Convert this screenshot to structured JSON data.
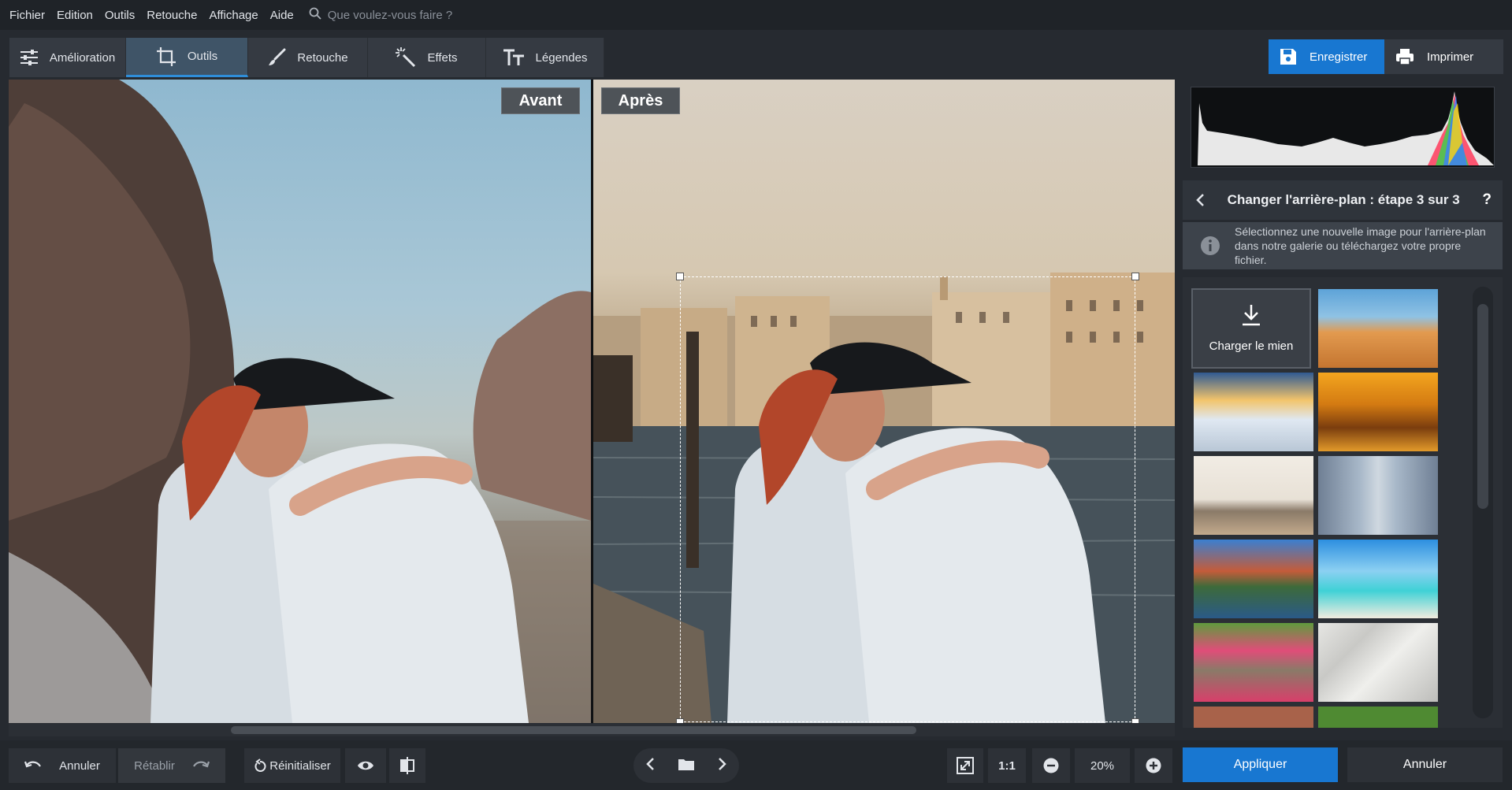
{
  "menu": [
    "Fichier",
    "Edition",
    "Outils",
    "Retouche",
    "Affichage",
    "Aide"
  ],
  "search": {
    "placeholder": "Que voulez-vous faire ?"
  },
  "toolbar": {
    "tabs": [
      "Amélioration",
      "Outils",
      "Retouche",
      "Effets",
      "Légendes"
    ],
    "active_tab": "Outils",
    "save_label": "Enregistrer",
    "print_label": "Imprimer"
  },
  "canvas": {
    "before_label": "Avant",
    "after_label": "Après"
  },
  "panel": {
    "step_title": "Changer l'arrière-plan : étape 3 sur 3",
    "help": "?",
    "info_text": "Sélectionnez une nouvelle image pour l'arrière-plan dans notre galerie ou téléchargez votre propre fichier.",
    "upload_label": "Charger le mien",
    "gallery": [
      "desert",
      "winter-road",
      "autumn-park",
      "living-room",
      "city-street",
      "canal-town",
      "tropical-beach",
      "flower-garden",
      "crumpled-paper",
      "brick-wall",
      "green-trees"
    ]
  },
  "bottom": {
    "undo_label": "Annuler",
    "redo_label": "Rétablir",
    "reset_label": "Réinitialiser",
    "one_to_one": "1:1",
    "zoom": "20%",
    "apply_label": "Appliquer",
    "cancel_label": "Annuler"
  },
  "colors": {
    "accent": "#1877d1",
    "background": "#262a30",
    "menubar": "#1f2328"
  }
}
